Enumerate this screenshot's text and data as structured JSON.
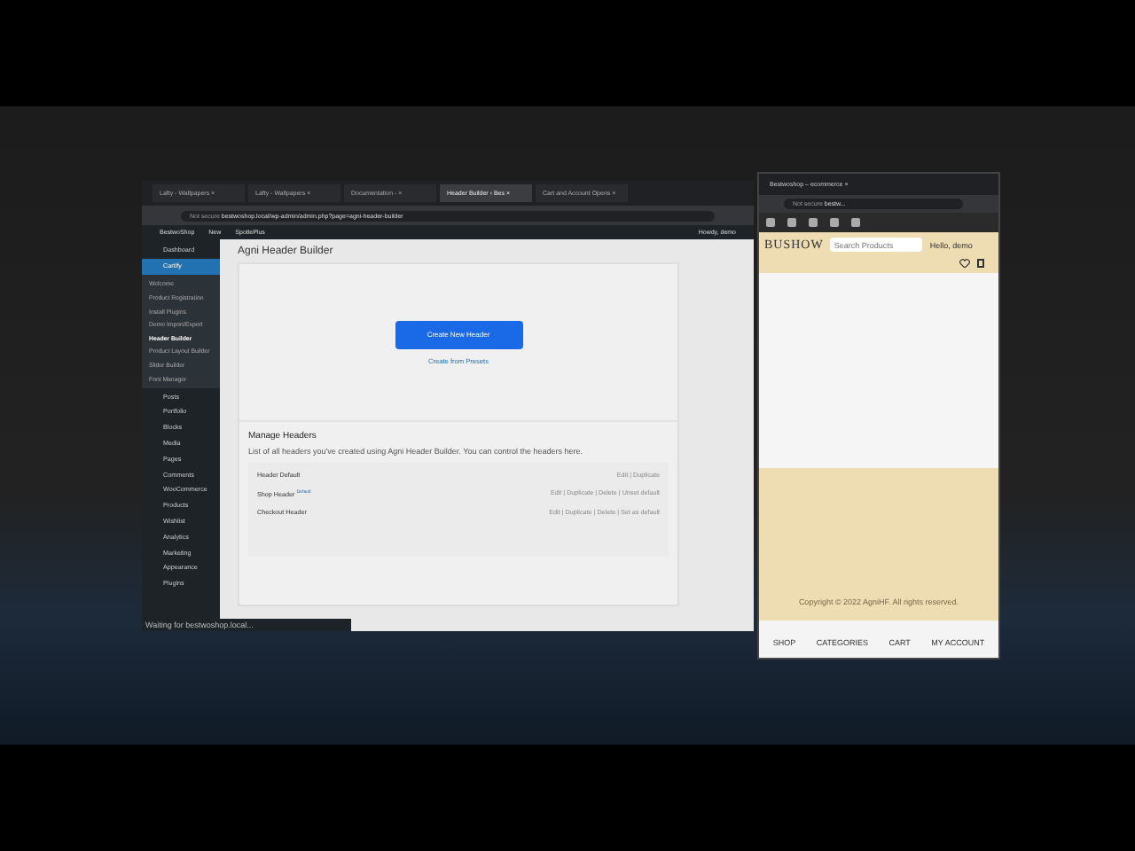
{
  "main_browser": {
    "tabs": [
      {
        "label": "Lafty - Wallpapers ×",
        "selected": false
      },
      {
        "label": "Lafty - Wallpapers ×",
        "selected": false
      },
      {
        "label": "Documentation - ×",
        "selected": false
      },
      {
        "label": "Header Builder ‹ Bes ×",
        "selected": true
      },
      {
        "label": "Cart and Account Opens ×",
        "selected": false
      }
    ],
    "address": {
      "security": "Not secure",
      "url": "bestwoshop.local/wp-admin/admin.php?page=agni-header-builder"
    },
    "admin_bar": {
      "site": "BestwoShop",
      "new": "New",
      "plugin": "SpotlePlus",
      "greeting": "Howdy, demo"
    },
    "sidebar": {
      "items": [
        {
          "label": "Dashboard",
          "selected": false
        },
        {
          "label": "Cartify",
          "selected": true,
          "children": [
            {
              "label": "Welcome",
              "selected": false
            },
            {
              "label": "Product Registration",
              "selected": false
            },
            {
              "label": "Install Plugins",
              "selected": false
            },
            {
              "label": "Demo Import/Export",
              "selected": false
            },
            {
              "label": "Header Builder",
              "selected": true
            },
            {
              "label": "Product Layout Builder",
              "selected": false
            },
            {
              "label": "Slider Builder",
              "selected": false
            },
            {
              "label": "Font Manager",
              "selected": false
            }
          ]
        },
        {
          "label": "Posts",
          "selected": false
        },
        {
          "label": "Portfolio",
          "selected": false
        },
        {
          "label": "Blocks",
          "selected": false
        },
        {
          "label": "Media",
          "selected": false
        },
        {
          "label": "Pages",
          "selected": false
        },
        {
          "label": "Comments",
          "selected": false
        },
        {
          "label": "WooCommerce",
          "selected": false
        },
        {
          "label": "Products",
          "selected": false
        },
        {
          "label": "Wishlist",
          "selected": false
        },
        {
          "label": "Analytics",
          "selected": false
        },
        {
          "label": "Marketing",
          "selected": false
        },
        {
          "label": "Appearance",
          "selected": false
        },
        {
          "label": "Plugins",
          "selected": false
        }
      ]
    },
    "page_title": "Agni Header Builder",
    "create_button": "Create New Header",
    "presets_link": "Create from Presets",
    "manage": {
      "title": "Manage Headers",
      "description": "List of all headers you've created using Agni Header Builder. You can control the headers here.",
      "rows": [
        {
          "name": "Header Default",
          "actions": "Edit | Duplicate"
        },
        {
          "name": "Shop Header",
          "badge": "Default",
          "actions": "Edit | Duplicate | Delete | Unset default"
        },
        {
          "name": "Checkout Header",
          "actions": "Edit | Duplicate | Delete | Set as default"
        }
      ]
    },
    "status_bar": "Waiting for bestwoshop.local..."
  },
  "phone_browser": {
    "tab": "Bestwoshop – ecommerce ×",
    "address": {
      "security": "Not secure",
      "url": "bestw..."
    },
    "logo": "BUSHOW",
    "search": {
      "placeholder": "Search Products"
    },
    "account": "Hello, demo",
    "footer": "Copyright © 2022 AgniHF. All rights reserved.",
    "bottom_nav": [
      {
        "label": "SHOP"
      },
      {
        "label": "CATEGORIES"
      },
      {
        "label": "CART"
      },
      {
        "label": "MY ACCOUNT"
      }
    ]
  }
}
